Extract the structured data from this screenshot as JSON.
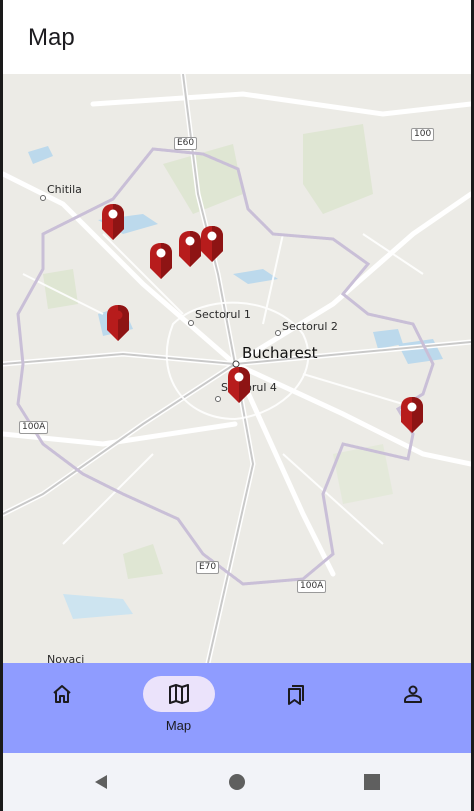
{
  "appbar": {
    "title": "Map"
  },
  "map": {
    "labels": {
      "chitila": "Chitila",
      "sectorul1": "Sectorul 1",
      "sectorul2": "Sectorul 2",
      "bucharest": "Bucharest",
      "sectorul4": "Sectorul 4",
      "novaci": "Novaci"
    },
    "shields": {
      "e60": "E60",
      "r100": "100",
      "r100a_west": "100A",
      "e70": "E70",
      "r100a_south": "100A"
    },
    "pin_color": "#b71c1c",
    "pin_count": 8
  },
  "nav": {
    "items": [
      {
        "label": "",
        "icon": "home-icon"
      },
      {
        "label": "Map",
        "icon": "map-icon"
      },
      {
        "label": "",
        "icon": "bookmarks-icon"
      },
      {
        "label": "",
        "icon": "person-icon"
      }
    ],
    "active_index": 1,
    "background": "#8f9cff",
    "active_pill": "#ebe3fb"
  },
  "system_nav": {
    "icons": [
      "back-icon",
      "home-circle-icon",
      "recents-icon"
    ]
  }
}
